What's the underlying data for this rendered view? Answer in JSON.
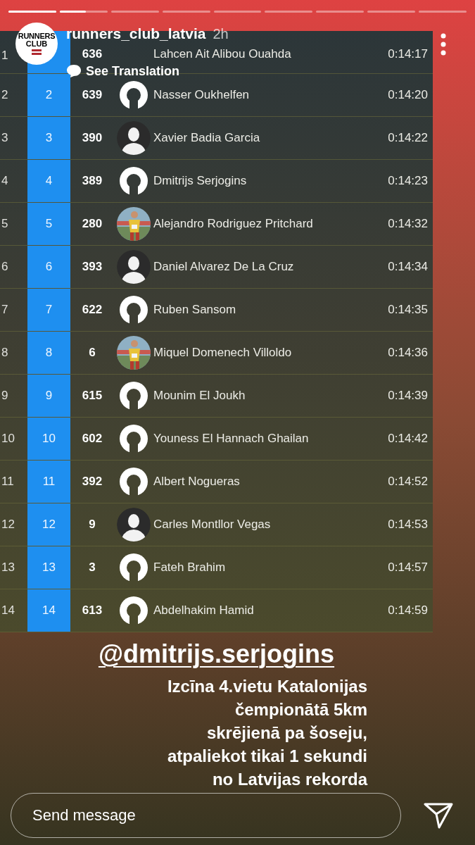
{
  "progress": [
    {
      "kind": "seen"
    },
    {
      "kind": "current"
    },
    {
      "kind": "unseen"
    },
    {
      "kind": "unseen"
    },
    {
      "kind": "unseen"
    },
    {
      "kind": "unseen"
    },
    {
      "kind": "unseen"
    },
    {
      "kind": "unseen"
    },
    {
      "kind": "unseen"
    }
  ],
  "header": {
    "logo": {
      "line1": "RUNNERS",
      "line2": "CLUB"
    },
    "username": "runners_club_latvia",
    "time": "2h",
    "translate": "See Translation"
  },
  "results": [
    {
      "rank": "1",
      "bib": "636",
      "name": "Lahcen Ait Alibou Ouahda",
      "time": "0:14:17"
    },
    {
      "rank": "2",
      "place": "2",
      "bib": "639",
      "avatar": {
        "kind": "light"
      },
      "name": "Nasser Oukhelfen",
      "time": "0:14:20"
    },
    {
      "rank": "3",
      "place": "3",
      "bib": "390",
      "avatar": {
        "kind": "dark"
      },
      "name": "Xavier Badia Garcia",
      "time": "0:14:22"
    },
    {
      "rank": "4",
      "place": "4",
      "bib": "389",
      "avatar": {
        "kind": "light"
      },
      "name": "Dmitrijs Serjogins",
      "time": "0:14:23"
    },
    {
      "rank": "5",
      "place": "5",
      "bib": "280",
      "name": "Alejandro Rodriguez Pritchard",
      "time": "0:14:32"
    },
    {
      "rank": "6",
      "place": "6",
      "bib": "393",
      "avatar": {
        "kind": "dark"
      },
      "name": "Daniel Alvarez De La Cruz",
      "time": "0:14:34"
    },
    {
      "rank": "7",
      "place": "7",
      "bib": "622",
      "avatar": {
        "kind": "light"
      },
      "name": "Ruben Sansom",
      "time": "0:14:35"
    },
    {
      "rank": "8",
      "place": "8",
      "bib": "6",
      "name": "Miquel Domenech Villoldo",
      "time": "0:14:36"
    },
    {
      "rank": "9",
      "place": "9",
      "bib": "615",
      "avatar": {
        "kind": "light"
      },
      "name": "Mounim El Joukh",
      "time": "0:14:39"
    },
    {
      "rank": "10",
      "place": "10",
      "bib": "602",
      "avatar": {
        "kind": "light"
      },
      "name": "Youness El Hannach Ghailan",
      "time": "0:14:42"
    },
    {
      "rank": "11",
      "place": "11",
      "bib": "392",
      "avatar": {
        "kind": "light"
      },
      "name": "Albert Nogueras",
      "time": "0:14:52"
    },
    {
      "rank": "12",
      "place": "12",
      "bib": "9",
      "avatar": {
        "kind": "dark"
      },
      "name": "Carles Montllor Vegas",
      "time": "0:14:53"
    },
    {
      "rank": "13",
      "place": "13",
      "bib": "3",
      "avatar": {
        "kind": "light"
      },
      "name": "Fateh Brahim",
      "time": "0:14:57"
    },
    {
      "rank": "14",
      "place": "14",
      "bib": "613",
      "avatar": {
        "kind": "light"
      },
      "name": "Abdelhakim Hamid",
      "time": "0:14:59"
    }
  ],
  "caption": {
    "mention": "@dmitrijs.serjogins",
    "text": "Izcīna 4.vietu Katalonijas\nčempionātā 5km\nskrējienā pa šoseju,\natpaliekot tikai 1 sekundi\nno Latvijas rekorda"
  },
  "message": {
    "placeholder": "Send message"
  }
}
